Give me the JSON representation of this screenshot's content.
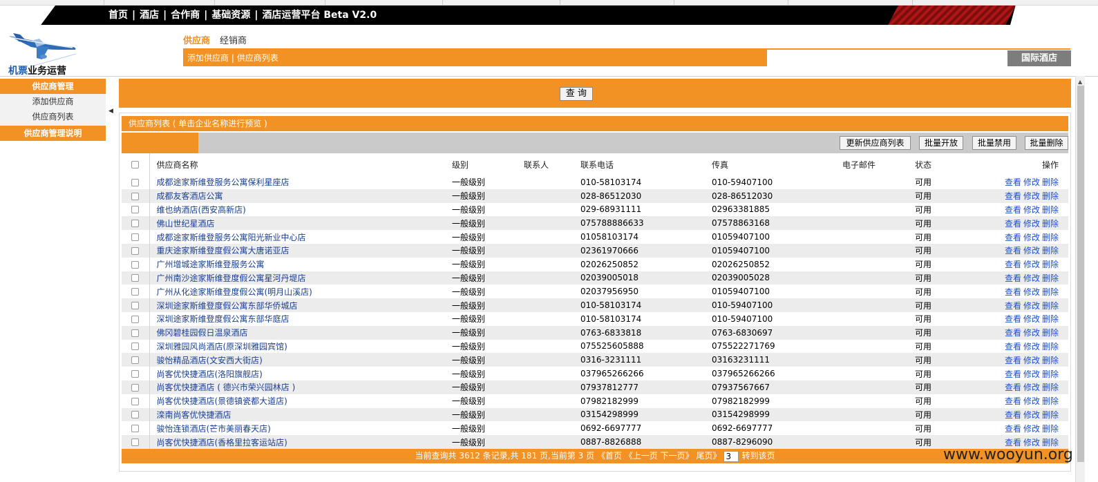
{
  "nav": {
    "items": [
      "首页",
      "酒店",
      "合作商",
      "基础资源",
      "酒店运营平台 Beta V2.0"
    ],
    "separator": "|"
  },
  "logo": {
    "text_blue": "机票",
    "text_black": "业务运营"
  },
  "subtabs": {
    "active": "供应商",
    "other": "经销商"
  },
  "sub_bar": {
    "add_link": "添加供应商",
    "separator": "|",
    "list_link": "供应商列表"
  },
  "intl_button": "国际酒店",
  "sidebar": {
    "header": "供应商管理",
    "items": [
      "添加供应商",
      "供应商列表"
    ],
    "footer": "供应商管理说明"
  },
  "query_button": "查 询",
  "list": {
    "title": "供应商列表 ( 单击企业名称进行预览 )",
    "toolbar": [
      "更新供应商列表",
      "批量开放",
      "批量禁用",
      "批量删除"
    ],
    "columns": [
      "供应商名称",
      "级别",
      "联系人",
      "联系电话",
      "传真",
      "电子邮件",
      "状态",
      "操作"
    ],
    "row_actions": [
      "查看",
      "修改",
      "删除"
    ],
    "rows": [
      {
        "name": "成都途家斯维登服务公寓保利星座店",
        "level": "一般级别",
        "contact": "",
        "phone": "010-58103174",
        "fax": "010-59407100",
        "email": "",
        "status": "可用"
      },
      {
        "name": "成都友客酒店公寓",
        "level": "一般级别",
        "contact": "",
        "phone": "028-86512030",
        "fax": "028-86512030",
        "email": "",
        "status": "可用"
      },
      {
        "name": "维也纳酒店(西安高新店)",
        "level": "一般级别",
        "contact": "",
        "phone": "029-68931111",
        "fax": "02963381885",
        "email": "",
        "status": "可用"
      },
      {
        "name": "佛山世纪星酒店",
        "level": "一般级别",
        "contact": "",
        "phone": "075788886633",
        "fax": "07578863168",
        "email": "",
        "status": "可用"
      },
      {
        "name": "成都途家斯维登服务公寓阳光新业中心店",
        "level": "一般级别",
        "contact": "",
        "phone": "01058103174",
        "fax": "01059407100",
        "email": "",
        "status": "可用"
      },
      {
        "name": "重庆途家斯维登度假公寓大唐诺亚店",
        "level": "一般级别",
        "contact": "",
        "phone": "02361970666",
        "fax": "01059407100",
        "email": "",
        "status": "可用"
      },
      {
        "name": "广州增城途家斯维登服务公寓",
        "level": "一般级别",
        "contact": "",
        "phone": "02026250852",
        "fax": "02026250852",
        "email": "",
        "status": "可用"
      },
      {
        "name": "广州南沙途家斯维登度假公寓星河丹堤店",
        "level": "一般级别",
        "contact": "",
        "phone": "02039005018",
        "fax": "02039005028",
        "email": "",
        "status": "可用"
      },
      {
        "name": "广州从化途家斯维登度假公寓(明月山溪店)",
        "level": "一般级别",
        "contact": "",
        "phone": "02037956950",
        "fax": "01059407100",
        "email": "",
        "status": "可用"
      },
      {
        "name": "深圳途家斯维登度假公寓东部华侨城店",
        "level": "一般级别",
        "contact": "",
        "phone": "010-58103174",
        "fax": "010-59407100",
        "email": "",
        "status": "可用"
      },
      {
        "name": "深圳途家斯维登度假公寓东部华庭店",
        "level": "一般级别",
        "contact": "",
        "phone": "010-58103174",
        "fax": "010-59407100",
        "email": "",
        "status": "可用"
      },
      {
        "name": "佛冈碧桂园假日温泉酒店",
        "level": "一般级别",
        "contact": "",
        "phone": "0763-6833818",
        "fax": "0763-6830697",
        "email": "",
        "status": "可用"
      },
      {
        "name": "深圳雅园风尚酒店(原深圳雅园宾馆)",
        "level": "一般级别",
        "contact": "",
        "phone": "075525605888",
        "fax": "075522271769",
        "email": "",
        "status": "可用"
      },
      {
        "name": "骏怡精品酒店(文安西大街店)",
        "level": "一般级别",
        "contact": "",
        "phone": "0316-3231111",
        "fax": "03163231111",
        "email": "",
        "status": "可用"
      },
      {
        "name": "尚客优快捷酒店(洛阳旗舰店)",
        "level": "一般级别",
        "contact": "",
        "phone": "037965266266",
        "fax": "037965266266",
        "email": "",
        "status": "可用"
      },
      {
        "name": "尚客优快捷酒店 ( 德兴市荣兴园林店 )",
        "level": "一般级别",
        "contact": "",
        "phone": "07937812777",
        "fax": "07937567667",
        "email": "",
        "status": "可用"
      },
      {
        "name": "尚客优快捷酒店(景德镇瓷都大道店)",
        "level": "一般级别",
        "contact": "",
        "phone": "07982182999",
        "fax": "07982182999",
        "email": "",
        "status": "可用"
      },
      {
        "name": "滦南尚客优快捷酒店",
        "level": "一般级别",
        "contact": "",
        "phone": "03154298999",
        "fax": "03154298999",
        "email": "",
        "status": "可用"
      },
      {
        "name": "骏怡连锁酒店(芒市美丽春天店)",
        "level": "一般级别",
        "contact": "",
        "phone": "0692-6697777",
        "fax": "0692-6697777",
        "email": "",
        "status": "可用"
      },
      {
        "name": "尚客优快捷酒店(香格里拉客运站店)",
        "level": "一般级别",
        "contact": "",
        "phone": "0887-8826888",
        "fax": "0887-8296090",
        "email": "",
        "status": "可用"
      }
    ]
  },
  "pager": {
    "summary": "当前查询共 3612 条记录,共 181 页,当前第 3 页",
    "first": "《首页",
    "prev": "《上一页",
    "next": "下一页》",
    "last": "尾页》",
    "page_value": "3",
    "goto": "转到该页"
  },
  "watermark": "www.wooyun.org",
  "colors": {
    "accent": "#f39224",
    "nav_bg": "#000000",
    "link": "#1a4fd0",
    "name_link": "#1a3f8f"
  }
}
